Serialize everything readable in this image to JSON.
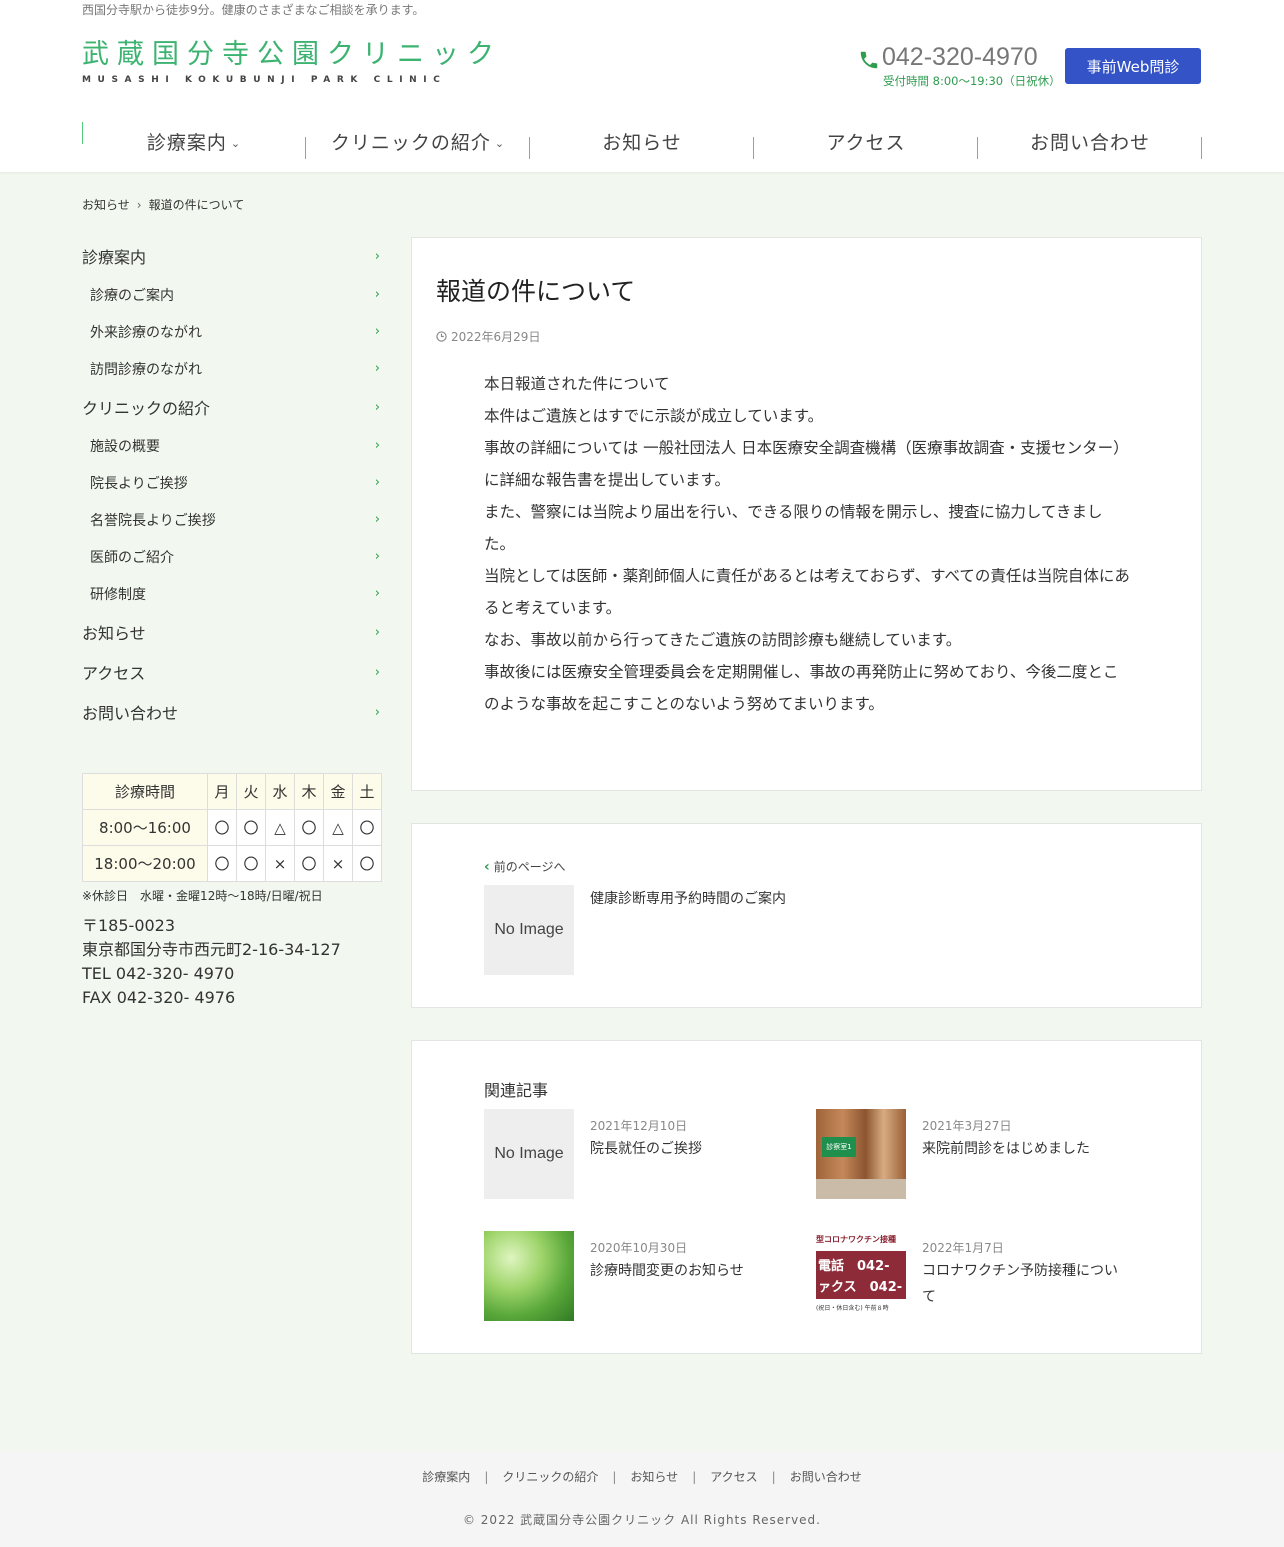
{
  "header": {
    "tagline": "西国分寺駅から徒歩9分。健康のさまざまなご相談を承ります。",
    "logo_jp": "武蔵国分寺公園クリニック",
    "logo_en": "MUSASHI KOKUBUNJI PARK CLINIC",
    "phone": "042-320-4970",
    "hours": "受付時間 8:00〜19:30（日祝休）",
    "web_button": "事前Web問診",
    "accent": "#3cb371",
    "button_color": "#3353c6"
  },
  "gnav": [
    {
      "label": "診療案内",
      "dropdown": true
    },
    {
      "label": "クリニックの紹介",
      "dropdown": true
    },
    {
      "label": "お知らせ",
      "dropdown": false
    },
    {
      "label": "アクセス",
      "dropdown": false
    },
    {
      "label": "お問い合わせ",
      "dropdown": false
    }
  ],
  "breadcrumb": {
    "parent": "お知らせ",
    "current": "報道の件について"
  },
  "sidebar": [
    {
      "label": "診療案内",
      "level": "top"
    },
    {
      "label": "診療のご案内",
      "level": "sub"
    },
    {
      "label": "外来診療のながれ",
      "level": "sub"
    },
    {
      "label": "訪問診療のながれ",
      "level": "sub"
    },
    {
      "label": "クリニックの紹介",
      "level": "top"
    },
    {
      "label": "施設の概要",
      "level": "sub"
    },
    {
      "label": "院長よりご挨拶",
      "level": "sub"
    },
    {
      "label": "名誉院長よりご挨拶",
      "level": "sub"
    },
    {
      "label": "医師のご紹介",
      "level": "sub"
    },
    {
      "label": "研修制度",
      "level": "sub"
    },
    {
      "label": "お知らせ",
      "level": "top"
    },
    {
      "label": "アクセス",
      "level": "top"
    },
    {
      "label": "お問い合わせ",
      "level": "top"
    }
  ],
  "schedule": {
    "header": [
      "診療時間",
      "月",
      "火",
      "水",
      "木",
      "金",
      "土"
    ],
    "rows": [
      [
        "8:00〜16:00",
        "〇",
        "〇",
        "△",
        "〇",
        "△",
        "〇"
      ],
      [
        "18:00〜20:00",
        "〇",
        "〇",
        "×",
        "〇",
        "×",
        "〇"
      ]
    ],
    "note": "※休診日　水曜・金曜12時〜18時/日曜/祝日"
  },
  "address": {
    "zip": "〒185-0023",
    "line": "東京都国分寺市西元町2-16-34-127",
    "tel": "TEL 042-320- 4970",
    "fax": "FAX 042-320- 4976"
  },
  "article": {
    "title": "報道の件について",
    "date": "2022年6月29日",
    "body": [
      "本日報道された件について",
      "本件はご遺族とはすでに示談が成立しています。",
      "事故の詳細については 一般社団法人 日本医療安全調査機構（医療事故調査・支援センター）に詳細な報告書を提出しています。",
      "また、警察には当院より届出を行い、できる限りの情報を開示し、捜査に協力してきました。",
      "当院としては医師・薬剤師個人に責任があるとは考えておらず、すべての責任は当院自体にあると考えています。",
      "なお、事故以前から行ってきたご遺族の訪問診療も継続しています。",
      "事故後には医療安全管理委員会を定期開催し、事故の再発防止に努めており、今後二度とこのような事故を起こすことのないよう努めてまいります。"
    ]
  },
  "prev": {
    "label": "前のページへ",
    "title": "健康診断専用予約時間のご案内",
    "thumb": "No Image"
  },
  "related": {
    "heading": "関連記事",
    "items": [
      {
        "date": "2021年12月10日",
        "title": "院長就任のご挨拶",
        "thumb": "No Image"
      },
      {
        "date": "2021年3月27日",
        "title": "来院前問診をはじめました",
        "thumb_text": "診察室1"
      },
      {
        "date": "2020年10月30日",
        "title": "診療時間変更のお知らせ"
      },
      {
        "date": "2022年1月7日",
        "title": "コロナワクチン予防接種について",
        "thumb_lines": [
          "型コロナワクチン接種",
          "電話　042-",
          "ァクス　042-",
          "(祝日・休日含む) 午前８時"
        ]
      }
    ]
  },
  "footer": {
    "nav": [
      "診療案内",
      "クリニックの紹介",
      "お知らせ",
      "アクセス",
      "お問い合わせ"
    ],
    "copyright": "© 2022 武蔵国分寺公園クリニック All Rights Reserved."
  }
}
